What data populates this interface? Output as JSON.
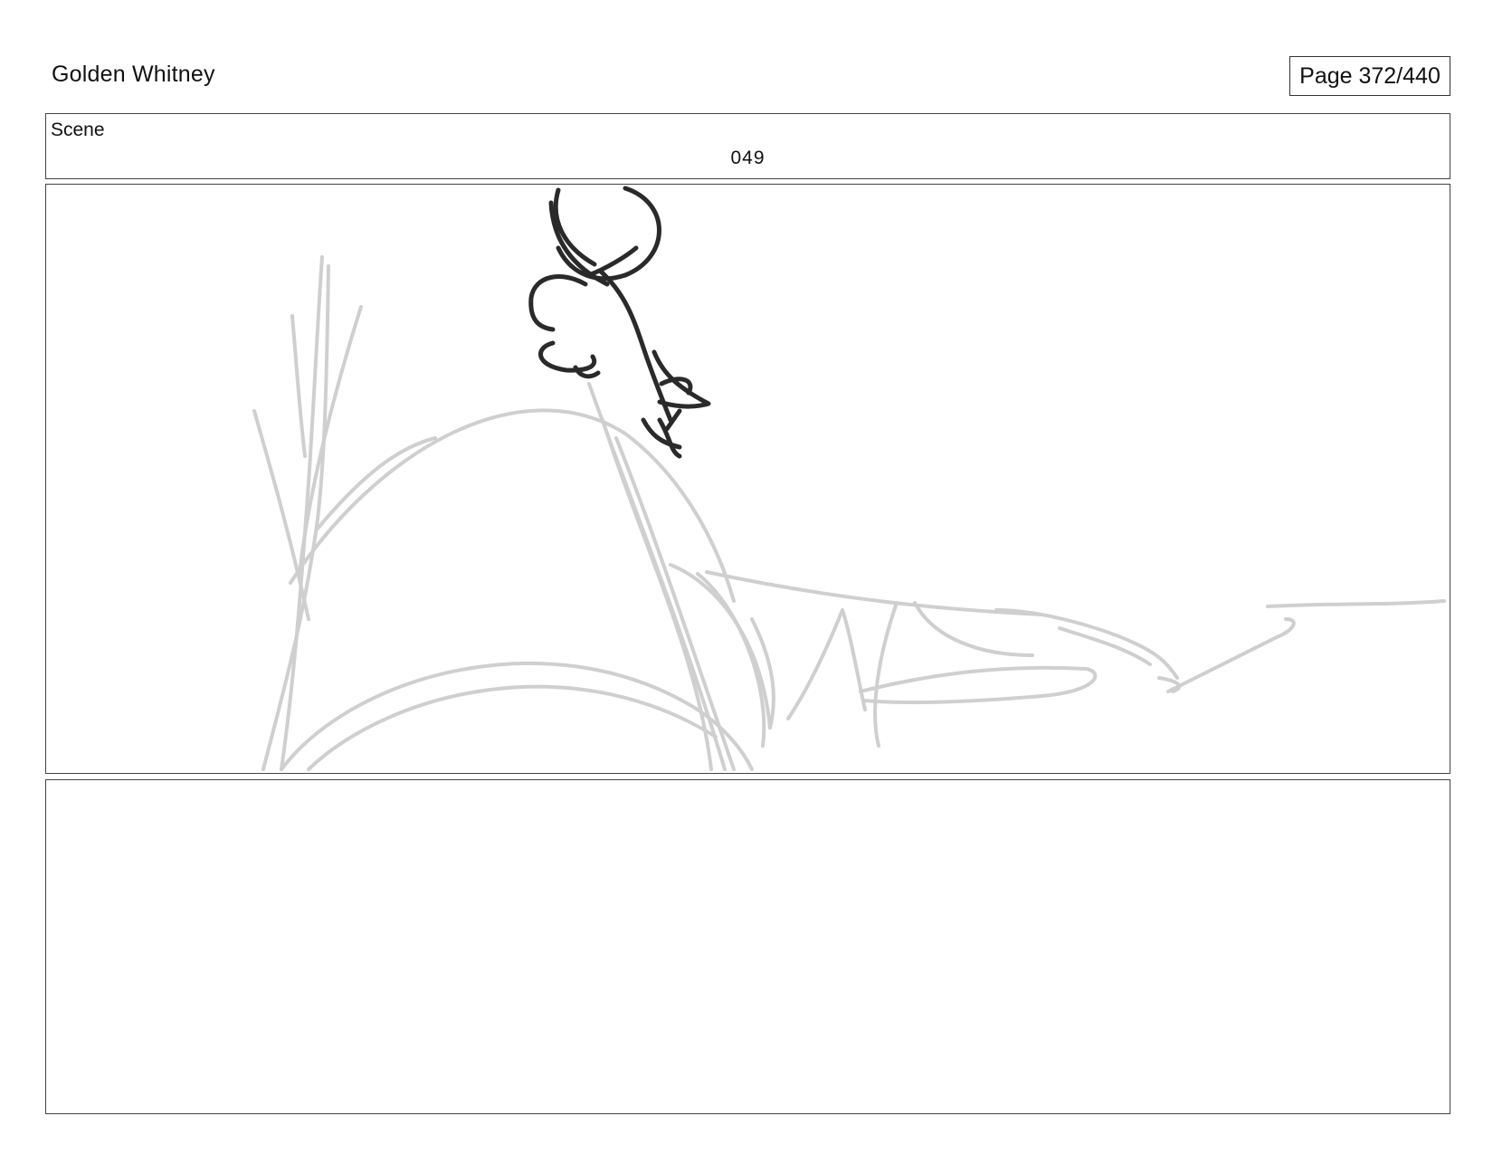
{
  "header": {
    "project_title": "Golden Whitney",
    "page_label": "Page 372/440"
  },
  "scene": {
    "label": "Scene",
    "number": "049"
  },
  "panel": {
    "sketch_colors": {
      "rough": "#cfcfcf",
      "ink": "#2a2a2a"
    }
  },
  "notes": {
    "text": ""
  }
}
